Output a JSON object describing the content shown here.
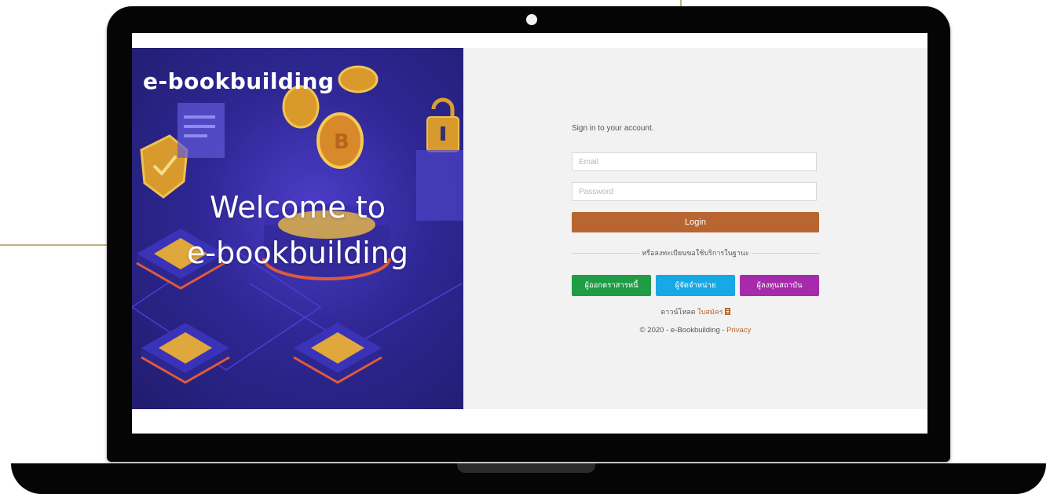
{
  "hero": {
    "logo_text": "e-bookbuilding",
    "title_line1": "Welcome to",
    "title_line2": "e-bookbuilding"
  },
  "login": {
    "signin_text": "Sign in to your account.",
    "email_placeholder": "Email",
    "password_placeholder": "Password",
    "login_label": "Login",
    "divider_text": "หรือลงทะเบียนขอใช้บริการในฐานะ",
    "roles": [
      {
        "label": "ผู้ออกตราสารหนี้",
        "color": "#1f9c45"
      },
      {
        "label": "ผู้จัดจำหน่าย",
        "color": "#17a8e6"
      },
      {
        "label": "ผู้ลงทุนสถาบัน",
        "color": "#a62aac"
      }
    ],
    "download_prefix": "ดาวน์โหลด",
    "download_link": "ใบสมัคร",
    "footer_text": "© 2020 - e-Bookbuilding -",
    "privacy_link": "Privacy"
  },
  "colors": {
    "accent": "#b86531",
    "hero_bg": "#2e2794",
    "panel_bg": "#f2f2f2"
  },
  "icons": {
    "download": "pdf-icon",
    "camera": "camera-icon"
  }
}
